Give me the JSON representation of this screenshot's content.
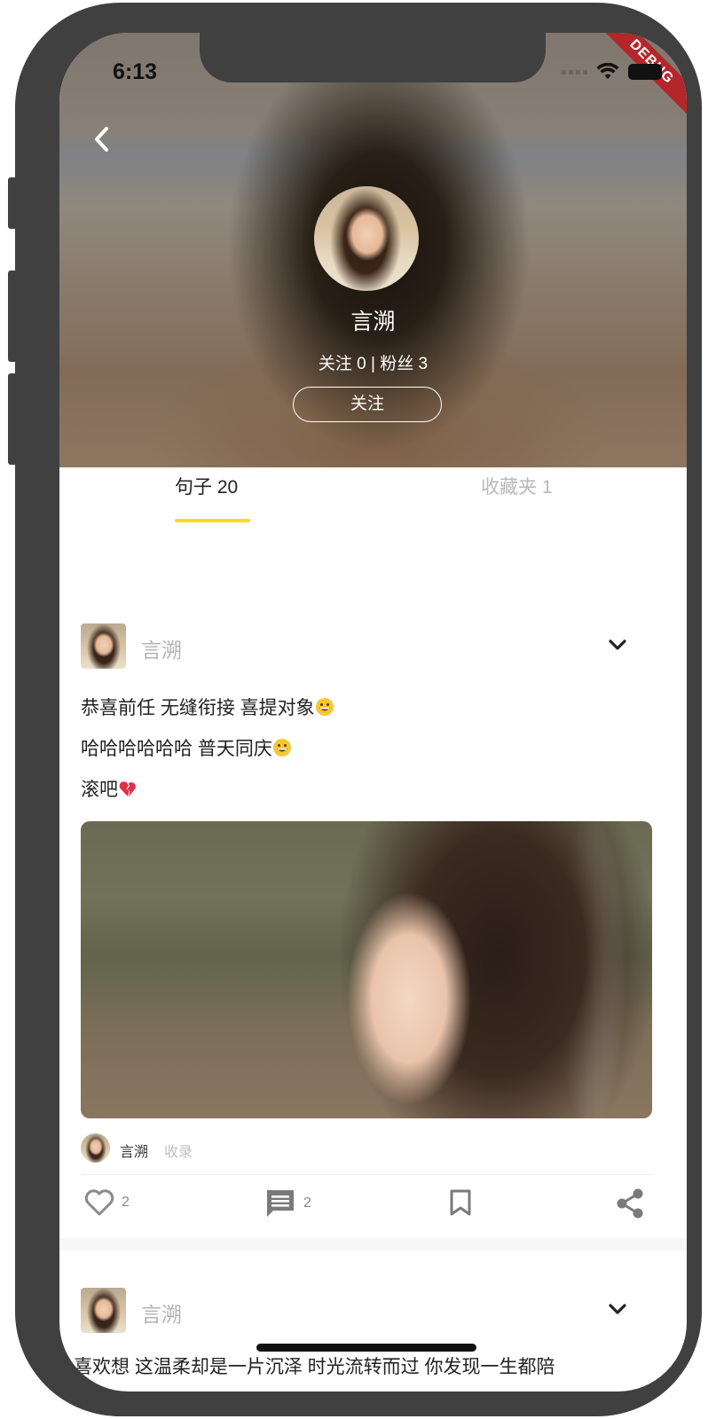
{
  "status_bar": {
    "time": "6:13"
  },
  "debug_banner": "DEBUG",
  "profile": {
    "name": "言溯",
    "stats": "关注 0 | 粉丝 3",
    "follow_label": "关注"
  },
  "tabs": [
    {
      "label": "句子 20",
      "active": true
    },
    {
      "label": "收藏夹 1",
      "active": false
    }
  ],
  "posts": [
    {
      "author": "言溯",
      "lines": [
        {
          "text": "恭喜前任  无缝衔接   喜提对象",
          "emoji": "grinning-face-emoji"
        },
        {
          "text": "哈哈哈哈哈哈  普天同庆",
          "emoji": "grinning-face-emoji"
        },
        {
          "text": "滚吧",
          "emoji": "broken-heart-emoji"
        }
      ],
      "meta_author": "言溯",
      "meta_tag": "收录",
      "likes": "2",
      "comments": "2"
    },
    {
      "author": "言溯",
      "partial_line": "喜欢想 这温柔却是一片沉泽 时光流转而过 你发现一生都陪"
    }
  ],
  "colors": {
    "tab_indicator": "#f6dd1a",
    "tab_active": "#222222",
    "tab_inactive": "#b8b8b8",
    "debug_ribbon": "#b3262a"
  }
}
